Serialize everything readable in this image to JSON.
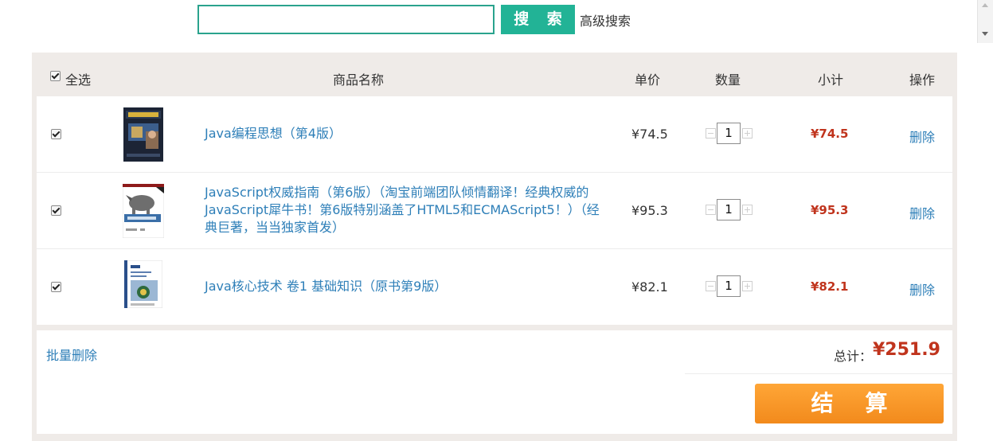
{
  "search": {
    "placeholder": "",
    "button_label": "搜 索",
    "advanced_label": "高级搜索"
  },
  "cart": {
    "headers": {
      "select_all": "全选",
      "name": "商品名称",
      "price": "单价",
      "quantity": "数量",
      "subtotal": "小计",
      "action": "操作"
    },
    "items": [
      {
        "cover": "thinking-in-java-cover",
        "name": "Java编程思想（第4版）",
        "price": "¥74.5",
        "quantity": "1",
        "subtotal": "¥74.5",
        "delete_label": "删除",
        "checked": true
      },
      {
        "cover": "javascript-definitive-guide-cover",
        "name": "JavaScript权威指南（第6版）（淘宝前端团队倾情翻译！经典权威的JavaScript犀牛书！第6版特别涵盖了HTML5和ECMAScript5！）（经典巨著，当当独家首发）",
        "price": "¥95.3",
        "quantity": "1",
        "subtotal": "¥95.3",
        "delete_label": "删除",
        "checked": true
      },
      {
        "cover": "core-java-cover",
        "name": "Java核心技术 卷1 基础知识（原书第9版）",
        "price": "¥82.1",
        "quantity": "1",
        "subtotal": "¥82.1",
        "delete_label": "删除",
        "checked": true
      }
    ],
    "footer": {
      "batch_delete": "批量删除",
      "total_label": "总计：",
      "total_value": "¥251.9",
      "checkout_label": "结算"
    }
  },
  "colors": {
    "accent": "#22b396",
    "price_red": "#c0341d",
    "link_blue": "#2e7fb8",
    "checkout_orange": "#f7951f",
    "panel_bg": "#efebe8"
  },
  "icons": {
    "checkbox": "checkmark-icon",
    "qty_minus": "minus-icon",
    "qty_plus": "plus-icon",
    "scroll_up": "scroll-up-arrow-icon",
    "scroll_down": "scroll-down-arrow-icon"
  }
}
